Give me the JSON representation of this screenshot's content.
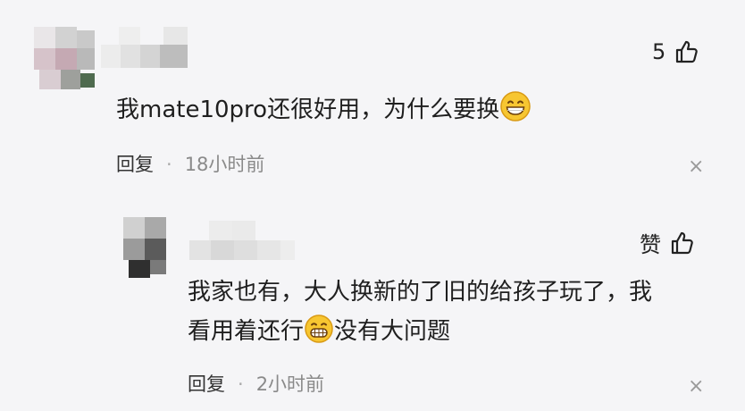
{
  "comment": {
    "like_count": "5",
    "text": "我mate10pro还很好用，为什么要换",
    "emoji": "grinning-face",
    "reply_label": "回复",
    "separator": "·",
    "time": "18小时前",
    "close_symbol": "×"
  },
  "reply": {
    "like_label": "赞",
    "text_line1": "我家也有，大人换新的了旧的给孩子玩了，我",
    "text_line2_before": "看用着还行",
    "text_line2_after": "没有大问题",
    "emoji": "grinning-teeth-face",
    "reply_label": "回复",
    "separator": "·",
    "time": "2小时前",
    "close_symbol": "×"
  }
}
